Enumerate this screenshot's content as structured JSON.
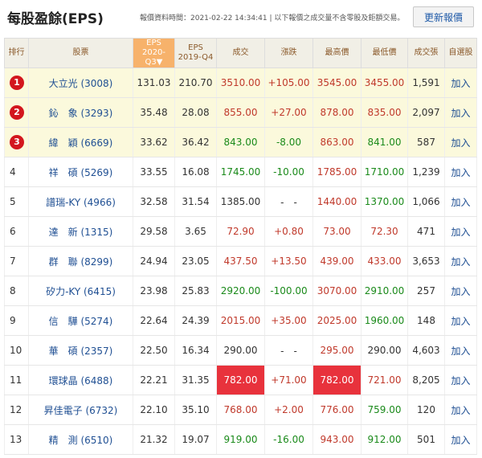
{
  "page": {
    "title": "每股盈餘(EPS)",
    "meta": "報價資料時間：2021-02-22 14:34:41 | 以下報價之成交量不含零股及鉅額交易。",
    "refresh_label": "更新報價"
  },
  "table": {
    "headers": [
      "排行",
      "股票",
      "EPS\n2020-Q3▼",
      "EPS\n2019-Q4",
      "成交",
      "漲跌",
      "最高價",
      "最低價",
      "成交張",
      "自選股"
    ],
    "rows": [
      {
        "rank": "1",
        "stock": "大立光 (3008)",
        "eps1": "131.03",
        "eps2": "210.70",
        "price": "3510.00",
        "chg": "+105.00",
        "high": "3545.00",
        "low": "3455.00",
        "vol": "1,591",
        "add": "加入",
        "pc": "red",
        "cc": "red",
        "hc": "red",
        "lc": "red",
        "hl": true,
        "badge": true
      },
      {
        "rank": "2",
        "stock": "鈊　象 (3293)",
        "eps1": "35.48",
        "eps2": "28.08",
        "price": "855.00",
        "chg": "+27.00",
        "high": "878.00",
        "low": "835.00",
        "vol": "2,097",
        "add": "加入",
        "pc": "red",
        "cc": "red",
        "hc": "red",
        "lc": "red",
        "hl": true,
        "badge": true
      },
      {
        "rank": "3",
        "stock": "緯　穎 (6669)",
        "eps1": "33.62",
        "eps2": "36.42",
        "price": "843.00",
        "chg": "-8.00",
        "high": "863.00",
        "low": "841.00",
        "vol": "587",
        "add": "加入",
        "pc": "green",
        "cc": "green",
        "hc": "red",
        "lc": "green",
        "hl": true,
        "badge": true
      },
      {
        "rank": "4",
        "stock": "祥　碩 (5269)",
        "eps1": "33.55",
        "eps2": "16.08",
        "price": "1745.00",
        "chg": "-10.00",
        "high": "1785.00",
        "low": "1710.00",
        "vol": "1,239",
        "add": "加入",
        "pc": "green",
        "cc": "green",
        "hc": "red",
        "lc": "green"
      },
      {
        "rank": "5",
        "stock": "譜瑞-KY (4966)",
        "eps1": "32.58",
        "eps2": "31.54",
        "price": "1385.00",
        "chg": "-　-",
        "high": "1440.00",
        "low": "1370.00",
        "vol": "1,066",
        "add": "加入",
        "pc": "dark",
        "cc": "dark",
        "hc": "red",
        "lc": "green"
      },
      {
        "rank": "6",
        "stock": "達　新 (1315)",
        "eps1": "29.58",
        "eps2": "3.65",
        "price": "72.90",
        "chg": "+0.80",
        "high": "73.00",
        "low": "72.30",
        "vol": "471",
        "add": "加入",
        "pc": "red",
        "cc": "red",
        "hc": "red",
        "lc": "red"
      },
      {
        "rank": "7",
        "stock": "群　聯 (8299)",
        "eps1": "24.94",
        "eps2": "23.05",
        "price": "437.50",
        "chg": "+13.50",
        "high": "439.00",
        "low": "433.00",
        "vol": "3,653",
        "add": "加入",
        "pc": "red",
        "cc": "red",
        "hc": "red",
        "lc": "red"
      },
      {
        "rank": "8",
        "stock": "矽力-KY (6415)",
        "eps1": "23.98",
        "eps2": "25.83",
        "price": "2920.00",
        "chg": "-100.00",
        "high": "3070.00",
        "low": "2910.00",
        "vol": "257",
        "add": "加入",
        "pc": "green",
        "cc": "green",
        "hc": "red",
        "lc": "green"
      },
      {
        "rank": "9",
        "stock": "信　驊 (5274)",
        "eps1": "22.64",
        "eps2": "24.39",
        "price": "2015.00",
        "chg": "+35.00",
        "high": "2025.00",
        "low": "1960.00",
        "vol": "148",
        "add": "加入",
        "pc": "red",
        "cc": "red",
        "hc": "red",
        "lc": "green"
      },
      {
        "rank": "10",
        "stock": "華　碩 (2357)",
        "eps1": "22.50",
        "eps2": "16.34",
        "price": "290.00",
        "chg": "-　-",
        "high": "295.00",
        "low": "290.00",
        "vol": "4,603",
        "add": "加入",
        "pc": "dark",
        "cc": "dark",
        "hc": "red",
        "lc": "dark"
      },
      {
        "rank": "11",
        "stock": "環球晶 (6488)",
        "eps1": "22.21",
        "eps2": "31.35",
        "price": "782.00",
        "chg": "+71.00",
        "high": "782.00",
        "low": "721.00",
        "vol": "8,205",
        "add": "加入",
        "pc": "redbox",
        "cc": "red",
        "hc": "redbox",
        "lc": "red"
      },
      {
        "rank": "12",
        "stock": "昇佳電子 (6732)",
        "eps1": "22.10",
        "eps2": "35.10",
        "price": "768.00",
        "chg": "+2.00",
        "high": "776.00",
        "low": "759.00",
        "vol": "120",
        "add": "加入",
        "pc": "red",
        "cc": "red",
        "hc": "red",
        "lc": "green"
      },
      {
        "rank": "13",
        "stock": "精　測 (6510)",
        "eps1": "21.32",
        "eps2": "19.07",
        "price": "919.00",
        "chg": "-16.00",
        "high": "943.00",
        "low": "912.00",
        "vol": "501",
        "add": "加入",
        "pc": "green",
        "cc": "green",
        "hc": "red",
        "lc": "green"
      }
    ]
  }
}
